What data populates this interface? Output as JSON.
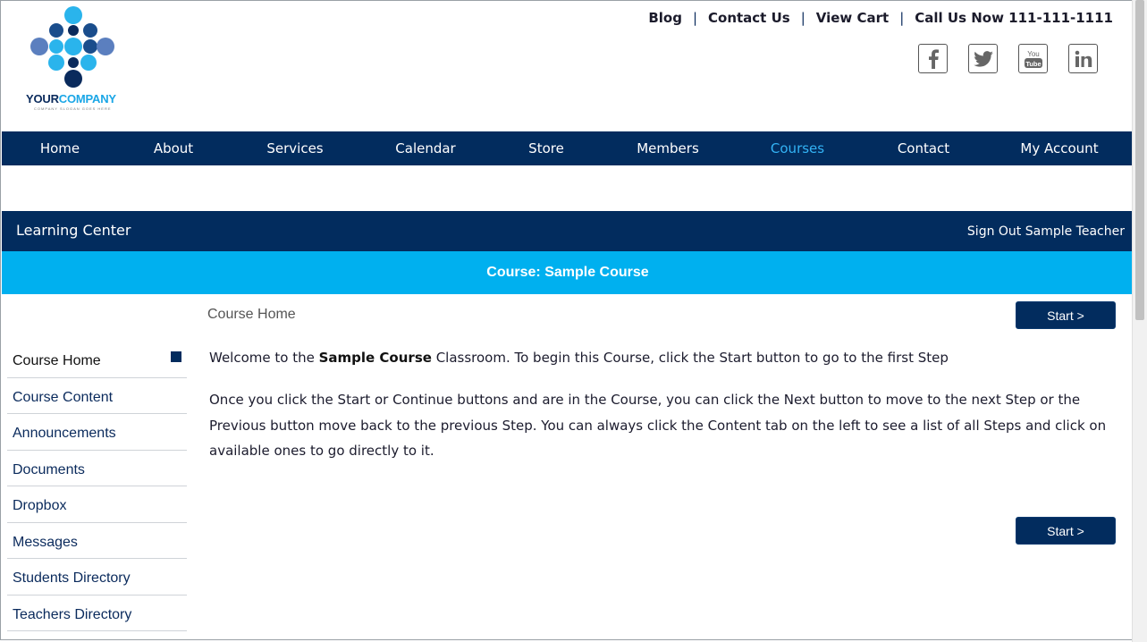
{
  "logo": {
    "word1": "YOUR",
    "word2": "COMPANY",
    "slogan": "COMPANY SLOGAN GOES HERE"
  },
  "toplinks": {
    "blog": "Blog",
    "contact": "Contact Us",
    "cart": "View Cart",
    "call": "Call Us Now 111-111-1111",
    "separator": "|"
  },
  "social": [
    "facebook-icon",
    "twitter-icon",
    "youtube-icon",
    "linkedin-icon"
  ],
  "colors": {
    "navy": "#022c5e",
    "accent": "#00b0ef",
    "active_nav": "#33b3f5"
  },
  "nav": {
    "items": [
      "Home",
      "About",
      "Services",
      "Calendar",
      "Store",
      "Members",
      "Courses",
      "Contact",
      "My Account"
    ],
    "active": "Courses"
  },
  "learning": {
    "title": "Learning Center",
    "signout": "Sign Out Sample Teacher"
  },
  "course": {
    "heading": "Course: Sample Course"
  },
  "sidebar": {
    "items": [
      "Course Home",
      "Course Content",
      "Announcements",
      "Documents",
      "Dropbox",
      "Messages",
      "Students Directory",
      "Teachers Directory"
    ],
    "active": "Course Home"
  },
  "content": {
    "title": "Course Home",
    "start_label": "Start >",
    "p1_before": "Welcome to the ",
    "p1_bold": "Sample Course",
    "p1_after": " Classroom. To begin this Course, click the Start button to go to the first Step",
    "p2": "Once you click the Start or Continue buttons and are in the Course, you can click the Next button to move to the next Step or the Previous button move back to the previous Step. You can always click the Content tab on the left to see a list of all Steps and click on available ones to go directly to it."
  }
}
